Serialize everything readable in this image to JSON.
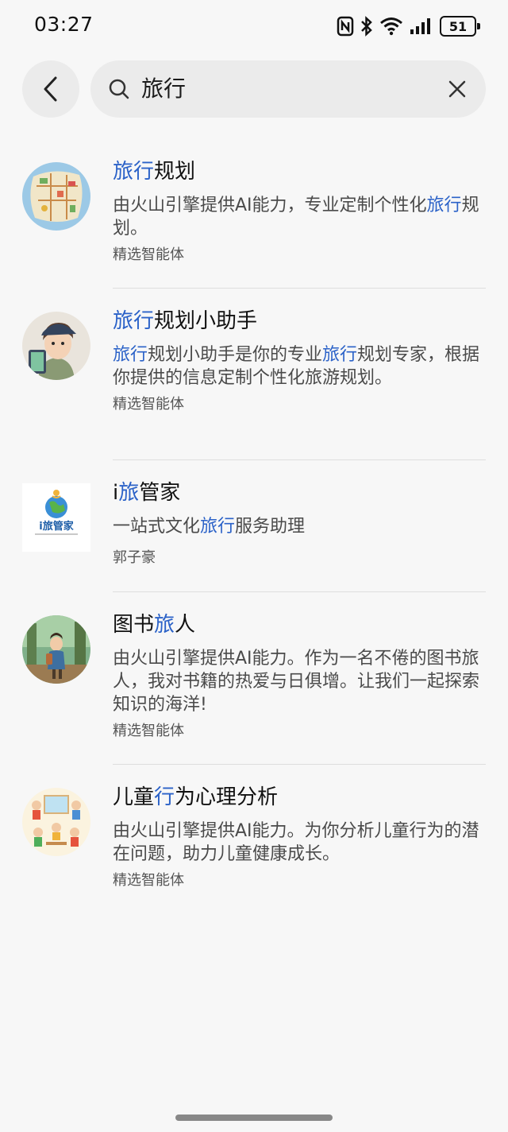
{
  "status_bar": {
    "time": "03:27",
    "battery": "51",
    "icons": [
      "nfc-icon",
      "bluetooth-icon",
      "wifi-icon",
      "signal-icon",
      "battery-icon"
    ]
  },
  "search": {
    "query": "旅行",
    "back_icon": "chevron-left-icon",
    "search_icon": "search-icon",
    "clear_icon": "close-icon"
  },
  "theme": {
    "highlight": "#2b62c8",
    "background": "#f7f7f7",
    "field": "#ebebeb"
  },
  "results": [
    {
      "title_parts": [
        {
          "text": "旅行",
          "hl": true
        },
        {
          "text": "规划",
          "hl": false
        }
      ],
      "desc_parts": [
        {
          "text": "由火山引擎提供AI能力，专业定制个性化",
          "hl": false
        },
        {
          "text": "旅行",
          "hl": true
        },
        {
          "text": "规划。",
          "hl": false
        }
      ],
      "meta": "精选智能体",
      "avatar": "map-avatar"
    },
    {
      "title_parts": [
        {
          "text": "旅行",
          "hl": true
        },
        {
          "text": "规划小助手",
          "hl": false
        }
      ],
      "desc_parts": [
        {
          "text": "旅行",
          "hl": true
        },
        {
          "text": "规划小助手是你的专业",
          "hl": false
        },
        {
          "text": "旅行",
          "hl": true
        },
        {
          "text": "规划专家，根据你提供的信息定制个性化旅游规划。",
          "hl": false
        }
      ],
      "meta": "精选智能体",
      "avatar": "traveler-girl-avatar"
    },
    {
      "title_parts": [
        {
          "text": "i",
          "hl": false
        },
        {
          "text": "旅",
          "hl": true
        },
        {
          "text": "管家",
          "hl": false
        }
      ],
      "desc_parts": [
        {
          "text": "一站式文化",
          "hl": false
        },
        {
          "text": "旅行",
          "hl": true
        },
        {
          "text": "服务助理",
          "hl": false
        }
      ],
      "meta": "郭子豪",
      "avatar": "globe-logo-avatar",
      "logo_text": "i旅管家"
    },
    {
      "title_parts": [
        {
          "text": "图书",
          "hl": false
        },
        {
          "text": "旅",
          "hl": true
        },
        {
          "text": "人",
          "hl": false
        }
      ],
      "desc_parts": [
        {
          "text": "由火山引擎提供AI能力。作为一名不倦的图书旅人，我对书籍的热爱与日俱增。让我们一起探索知识的海洋!",
          "hl": false
        }
      ],
      "meta": "精选智能体",
      "avatar": "forest-reader-avatar"
    },
    {
      "title_parts": [
        {
          "text": "儿童",
          "hl": false
        },
        {
          "text": "行",
          "hl": true
        },
        {
          "text": "为心理分析",
          "hl": false
        }
      ],
      "desc_parts": [
        {
          "text": "由火山引擎提供AI能力。为你分析儿童行为的潜在问题，助力儿童健康成长。",
          "hl": false
        }
      ],
      "meta": "精选智能体",
      "avatar": "kids-cartoon-avatar"
    }
  ]
}
